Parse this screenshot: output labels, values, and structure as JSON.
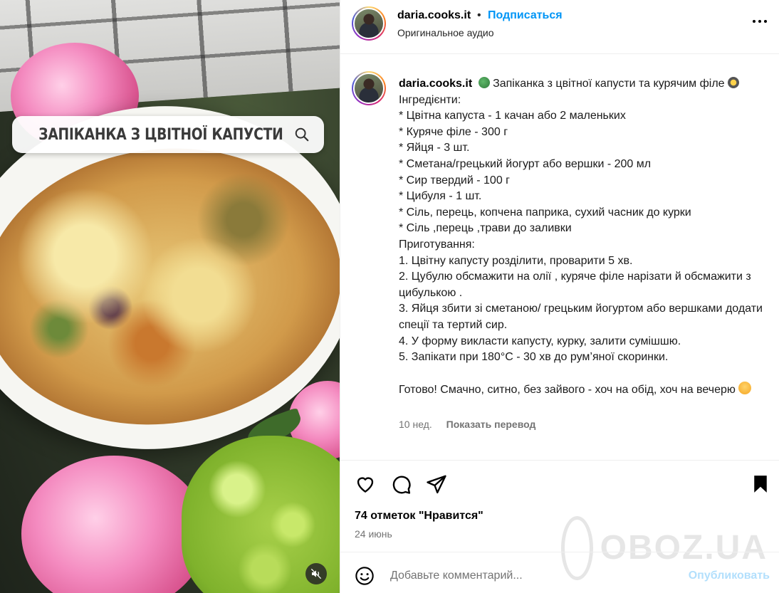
{
  "overlay": {
    "search_text": "ЗАПІКАНКА З ЦВІТНОЇ КАПУСТИ"
  },
  "header": {
    "username": "daria.cooks.it",
    "separator": "•",
    "follow_label": "Подписаться",
    "audio": "Оригинальное аудио"
  },
  "caption": {
    "username": "daria.cooks.it",
    "title": "Запіканка з цвітної капусти та курячим філе",
    "lines": [
      "Інгредієнти:",
      "* Цвітна капуста - 1 качан або 2 маленьких",
      "* Куряче філе - 300 г",
      "* Яйця - 3 шт.",
      "* Сметана/грецький йогурт або вершки - 200 мл",
      "* Сир твердий - 100 г",
      "* Цибуля - 1 шт.",
      "* Сіль, перець, копчена паприка, сухий часник до курки",
      "* Сіль ,перець ,трави до заливки",
      "Приготування:",
      "1. Цвітну капусту розділити, проварити 5 хв.",
      "2. Цубулю обсмажити на олії , куряче філе нарізати й обсмажити з цибулькою .",
      "3. Яйця збити зі сметаною/ грецьким йогуртом або вершками додати спеції та тертий сир.",
      "4. У форму викласти капусту, курку, залити сумішшю.",
      "5. Запікати при 180°C - 30 хв до рум’яної скоринки.",
      "",
      "Готово! Смачно, ситно, без зайвого - хоч на обід, хоч на вечерю"
    ],
    "age": "10 нед.",
    "translate_label": "Показать перевод"
  },
  "icons": {
    "title_emoji": "broccoli-icon",
    "title_emoji_end": "pan-icon",
    "ending_emoji": "smiling-face-icon"
  },
  "engagement": {
    "likes": "74 отметок \"Нравится\"",
    "date": "24 июнь"
  },
  "comment": {
    "placeholder": "Добавьте комментарий...",
    "post_label": "Опубликовать"
  },
  "watermark": {
    "text": "OBOZ.UA"
  },
  "colors": {
    "accent": "#0095f6",
    "post_disabled": "#b2dffc",
    "muted": "#737373",
    "border": "#efefef"
  }
}
